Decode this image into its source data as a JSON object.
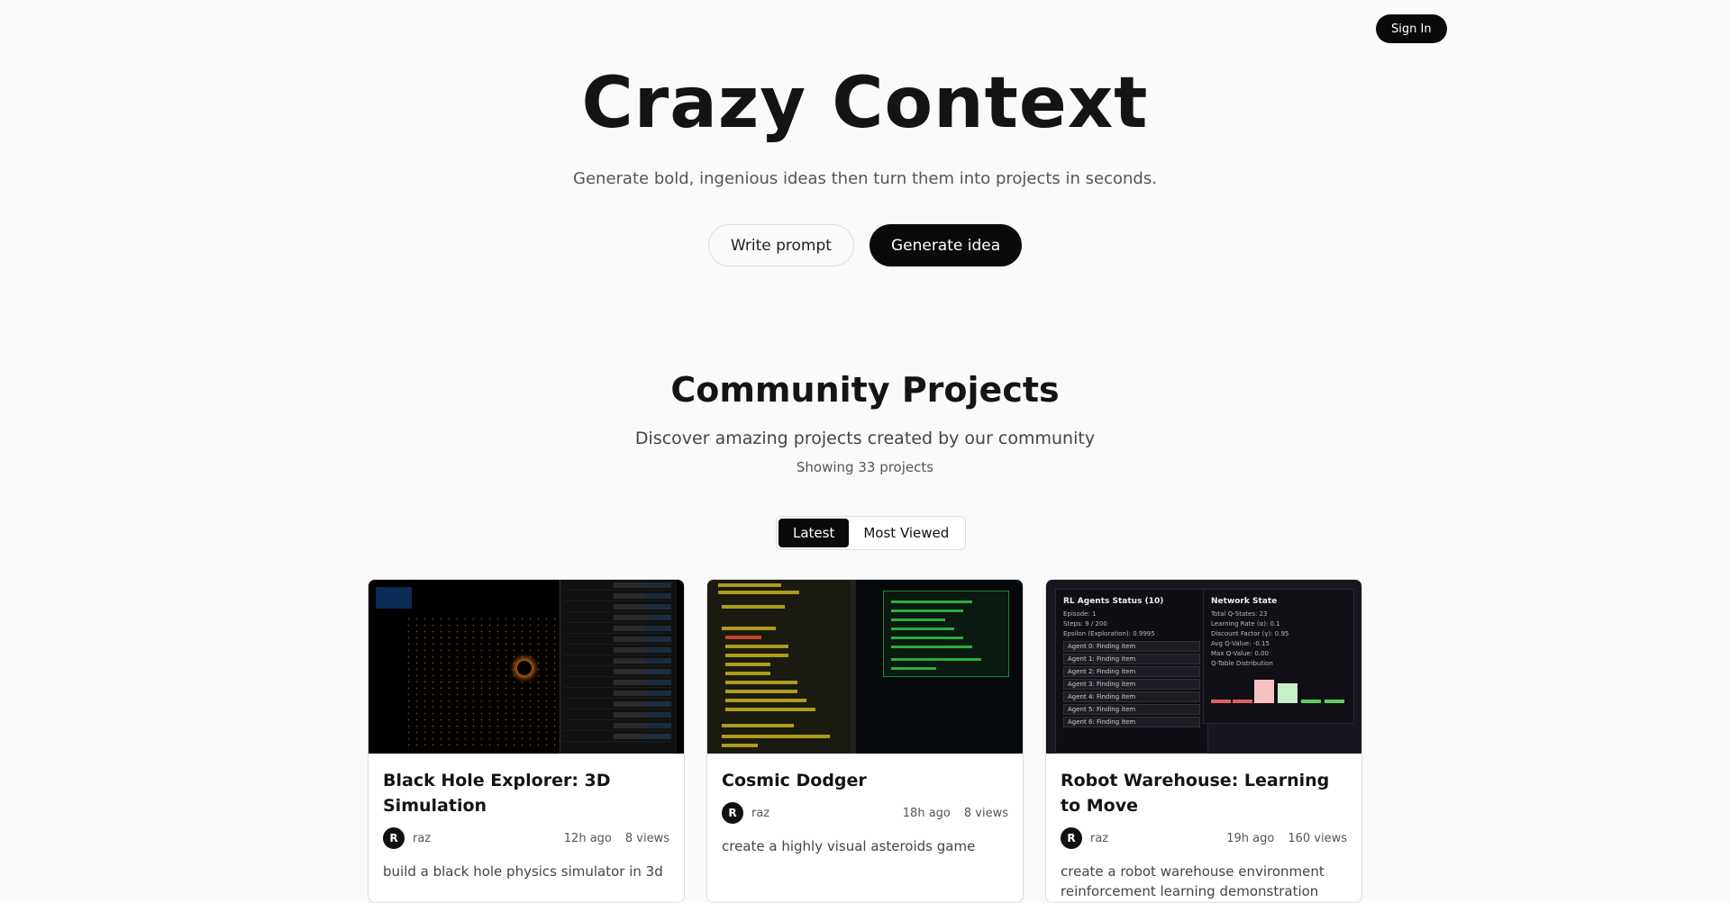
{
  "header": {
    "signin_label": "Sign In"
  },
  "hero": {
    "title": "Crazy Context",
    "subtitle": "Generate bold, ingenious ideas then turn them into projects in seconds.",
    "write_prompt_label": "Write prompt",
    "generate_idea_label": "Generate idea"
  },
  "community": {
    "title": "Community Projects",
    "description": "Discover amazing projects created by our community",
    "count_text": "Showing 33 projects",
    "tabs": [
      {
        "label": "Latest",
        "active": true
      },
      {
        "label": "Most Viewed",
        "active": false
      }
    ]
  },
  "projects": [
    {
      "title": "Black Hole Explorer: 3D Simulation",
      "author_initial": "R",
      "author": "raz",
      "time": "12h ago",
      "views": "8 views",
      "description": "build a black hole physics simulator in 3d"
    },
    {
      "title": "Cosmic Dodger",
      "author_initial": "R",
      "author": "raz",
      "time": "18h ago",
      "views": "8 views",
      "description": "create a highly visual asteroids game"
    },
    {
      "title": "Robot Warehouse: Learning to Move",
      "author_initial": "R",
      "author": "raz",
      "time": "19h ago",
      "views": "160 views",
      "description": "create a robot warehouse environment reinforcement learning demonstration"
    }
  ],
  "thumb_robot": {
    "left_title": "RL Agents Status (10)",
    "left_lines": [
      "Episode: 1",
      "Steps: 9 / 200",
      "Epsilon (Exploration): 0.9995"
    ],
    "agents": [
      "Agent 0: Finding item",
      "Agent 1: Finding item",
      "Agent 2: Finding item",
      "Agent 3: Finding item",
      "Agent 4: Finding item",
      "Agent 5: Finding item",
      "Agent 6: Finding item"
    ],
    "right_title": "Network State",
    "right_lines": [
      "Total Q-States: 23",
      "Learning Rate (α): 0.1",
      "Discount Factor (γ): 0.95",
      "Avg Q-Value: -0.15",
      "Max Q-Value: 0.00",
      "Q-Table Distribution"
    ]
  },
  "colors": {
    "primary": "#0a0a0a",
    "background": "#fafafa"
  }
}
